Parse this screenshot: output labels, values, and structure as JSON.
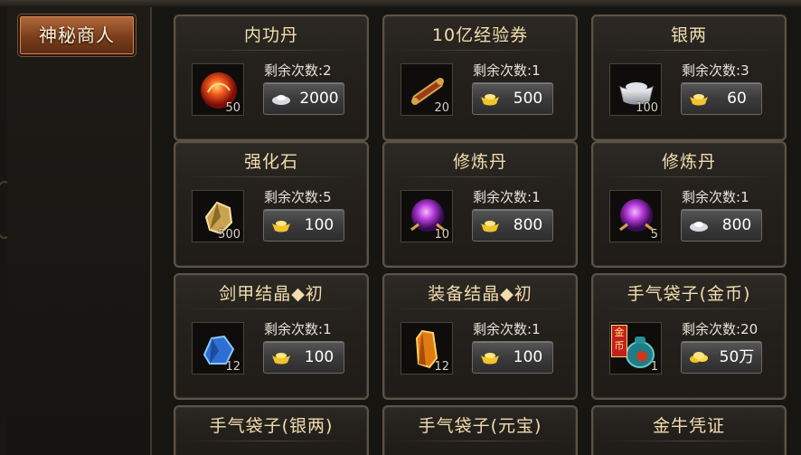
{
  "sidebar": {
    "active_tab": "神秘商人"
  },
  "colors": {
    "title": "#f3dcae",
    "tab": "#8a4622",
    "button": "#454545"
  },
  "remain_label": "剩余次数:",
  "items": [
    {
      "name": "内功丹",
      "remain": "2",
      "qty": "50",
      "price": "2000",
      "currency": "silver-icon",
      "icon": "red-orb-icon"
    },
    {
      "name": "10亿经验券",
      "remain": "1",
      "qty": "20",
      "price": "500",
      "currency": "gold-ingot-icon",
      "icon": "scroll-icon"
    },
    {
      "name": "银两",
      "remain": "3",
      "qty": "100",
      "price": "60",
      "currency": "gold-ingot-icon",
      "icon": "silver-ingot-icon"
    },
    {
      "name": "强化石",
      "remain": "5",
      "qty": "500",
      "price": "100",
      "currency": "gold-ingot-icon",
      "icon": "gold-stone-icon"
    },
    {
      "name": "修炼丹",
      "remain": "1",
      "qty": "10",
      "price": "800",
      "currency": "gold-ingot-icon",
      "icon": "purple-orb-icon"
    },
    {
      "name": "修炼丹",
      "remain": "1",
      "qty": "5",
      "price": "800",
      "currency": "silver-icon",
      "icon": "purple-orb-icon"
    },
    {
      "name": "剑甲结晶◆初",
      "remain": "1",
      "qty": "12",
      "price": "100",
      "currency": "gold-ingot-icon",
      "icon": "blue-crystal-icon"
    },
    {
      "name": "装备结晶◆初",
      "remain": "1",
      "qty": "12",
      "price": "100",
      "currency": "gold-ingot-icon",
      "icon": "orange-crystal-icon"
    },
    {
      "name": "手气袋子(金币)",
      "remain": "20",
      "qty": "1",
      "price": "50万",
      "currency": "gold-coins-icon",
      "icon": "lucky-bag-icon",
      "badge": "金币"
    }
  ],
  "partial_items": [
    {
      "name": "手气袋子(银两)"
    },
    {
      "name": "手气袋子(元宝)"
    },
    {
      "name": "金牛凭证"
    }
  ]
}
